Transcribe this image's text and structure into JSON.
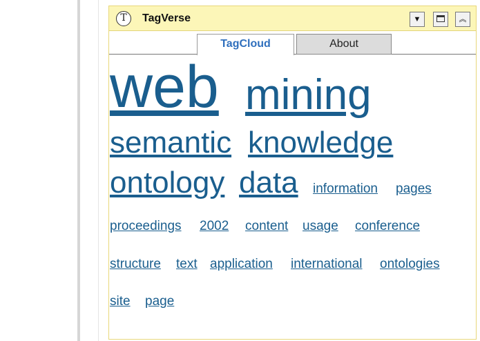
{
  "widget": {
    "logo": "T",
    "title": "TagVerse",
    "controls": {
      "dropdown": "▼",
      "maximize": "",
      "collapse": "︽"
    }
  },
  "tabs": [
    {
      "label": "TagCloud",
      "active": true
    },
    {
      "label": "About",
      "active": false
    }
  ],
  "tags": [
    {
      "text": "web"
    },
    {
      "text": "mining"
    },
    {
      "text": "semantic"
    },
    {
      "text": "knowledge"
    },
    {
      "text": "ontology"
    },
    {
      "text": "data"
    },
    {
      "text": "information"
    },
    {
      "text": "pages"
    },
    {
      "text": "proceedings"
    },
    {
      "text": "2002"
    },
    {
      "text": "content"
    },
    {
      "text": "usage"
    },
    {
      "text": "conference"
    },
    {
      "text": "structure"
    },
    {
      "text": "text"
    },
    {
      "text": "application"
    },
    {
      "text": "international"
    },
    {
      "text": "ontologies"
    },
    {
      "text": "site"
    },
    {
      "text": "page"
    }
  ]
}
